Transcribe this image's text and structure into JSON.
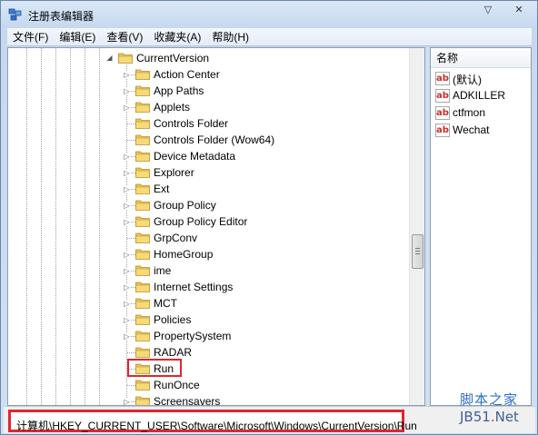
{
  "window": {
    "title": "注册表编辑器"
  },
  "window_controls": {
    "minimize": "▽",
    "close": "✕"
  },
  "menu": [
    {
      "label": "文件(F)"
    },
    {
      "label": "编辑(E)"
    },
    {
      "label": "查看(V)"
    },
    {
      "label": "收藏夹(A)"
    },
    {
      "label": "帮助(H)"
    }
  ],
  "tree": {
    "parent": {
      "label": "CurrentVersion",
      "expander": "◢"
    },
    "children": [
      {
        "label": "Action Center",
        "expander": "▷"
      },
      {
        "label": "App Paths",
        "expander": "▷"
      },
      {
        "label": "Applets",
        "expander": "▷"
      },
      {
        "label": "Controls Folder",
        "expander": ""
      },
      {
        "label": "Controls Folder (Wow64)",
        "expander": ""
      },
      {
        "label": "Device Metadata",
        "expander": "▷"
      },
      {
        "label": "Explorer",
        "expander": "▷"
      },
      {
        "label": "Ext",
        "expander": "▷"
      },
      {
        "label": "Group Policy",
        "expander": "▷"
      },
      {
        "label": "Group Policy Editor",
        "expander": "▷"
      },
      {
        "label": "GrpConv",
        "expander": ""
      },
      {
        "label": "HomeGroup",
        "expander": "▷"
      },
      {
        "label": "ime",
        "expander": "▷"
      },
      {
        "label": "Internet Settings",
        "expander": "▷"
      },
      {
        "label": "MCT",
        "expander": "▷"
      },
      {
        "label": "Policies",
        "expander": "▷"
      },
      {
        "label": "PropertySystem",
        "expander": "▷"
      },
      {
        "label": "RADAR",
        "expander": ""
      },
      {
        "label": "Run",
        "expander": "",
        "selected": true
      },
      {
        "label": "RunOnce",
        "expander": ""
      },
      {
        "label": "Screensavers",
        "expander": "▷"
      }
    ]
  },
  "values": {
    "column_name": "名称",
    "icon_text": "ab",
    "items": [
      {
        "name": "(默认)"
      },
      {
        "name": "ADKILLER"
      },
      {
        "name": "ctfmon"
      },
      {
        "name": "Wechat"
      }
    ]
  },
  "status": {
    "path": "计算机\\HKEY_CURRENT_USER\\Software\\Microsoft\\Windows\\CurrentVersion\\Run"
  },
  "watermark": {
    "line1": "脚本之家",
    "line2_a": "JB51",
    "line2_b": ".",
    "line2_c": "Net"
  },
  "colors": {
    "highlight_red": "#e0262f",
    "folder_yellow": "#e8c45a",
    "watermark_blue": "#2d6fc4"
  }
}
